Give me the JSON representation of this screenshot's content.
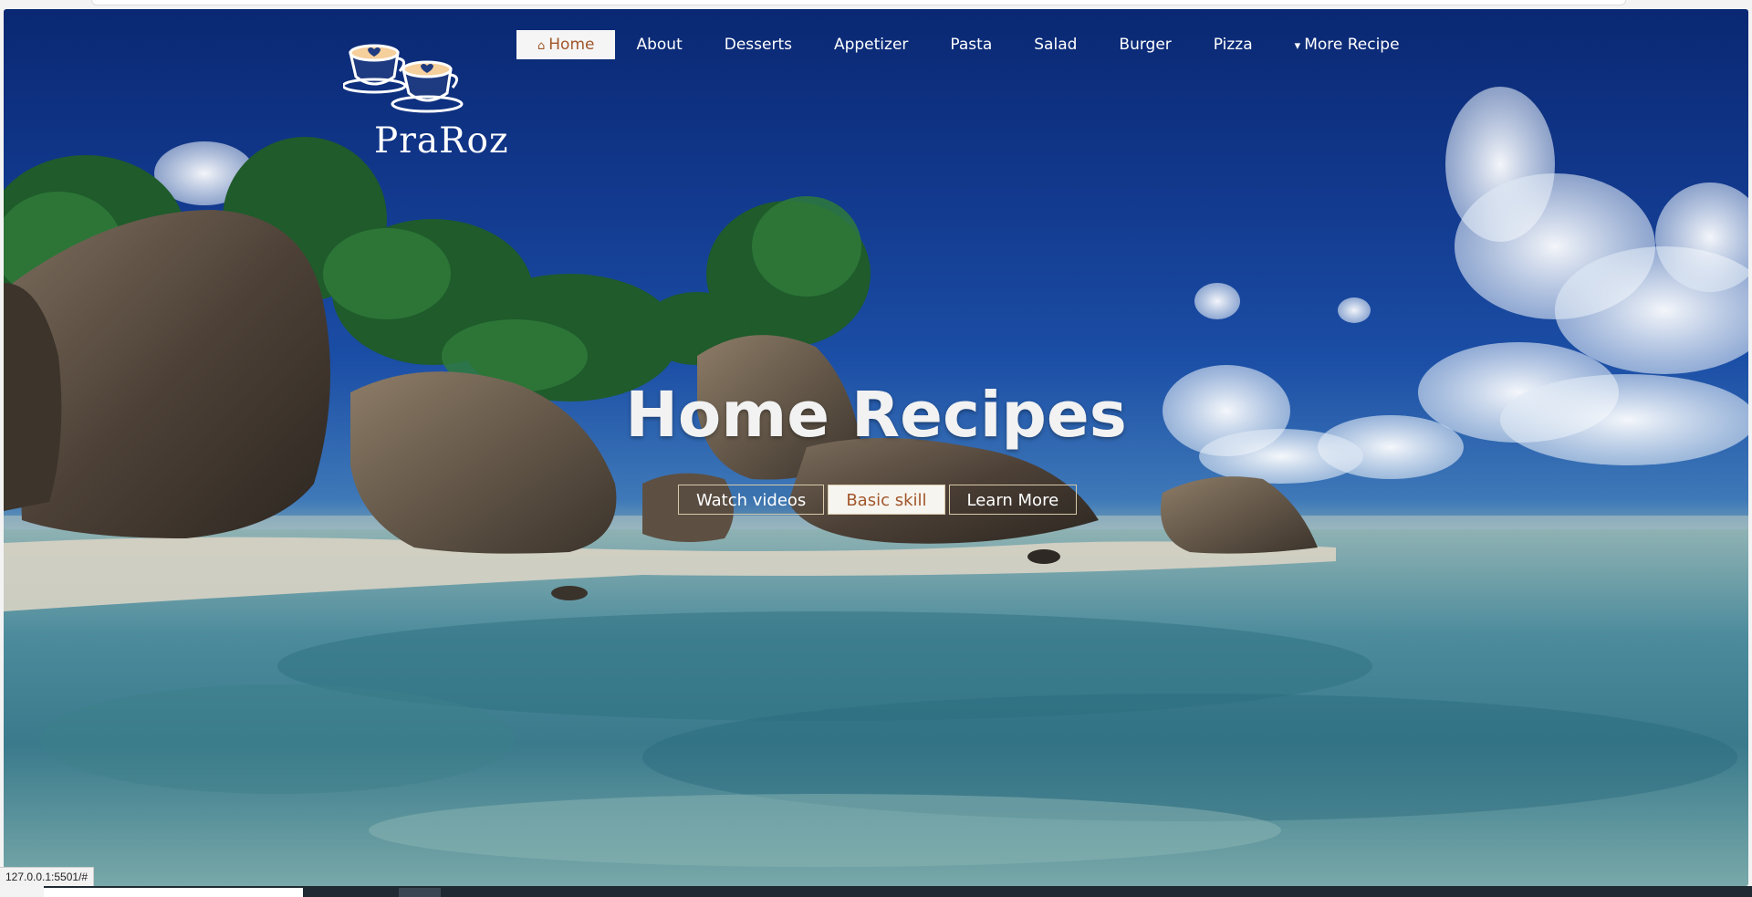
{
  "colors": {
    "accent": "#a1562a",
    "nav_active_bg": "#f5f5f5",
    "button_border": "#d8c9a9"
  },
  "brand": {
    "name": "PraRoz",
    "logo_icon": "coffee-cups-heart-icon"
  },
  "nav": {
    "items": [
      {
        "label": "Home",
        "icon": "home-icon",
        "active": true
      },
      {
        "label": "About"
      },
      {
        "label": "Desserts"
      },
      {
        "label": "Appetizer"
      },
      {
        "label": "Pasta"
      },
      {
        "label": "Salad"
      },
      {
        "label": "Burger"
      },
      {
        "label": "Pizza"
      },
      {
        "label": "More Recipe",
        "icon": "caret-down-icon"
      }
    ]
  },
  "hero": {
    "title": "Home Recipes",
    "buttons": [
      {
        "label": "Watch videos"
      },
      {
        "label": "Basic skill",
        "active": true
      },
      {
        "label": "Learn More"
      }
    ]
  },
  "status_bar": {
    "url": "127.0.0.1:5501/#"
  }
}
